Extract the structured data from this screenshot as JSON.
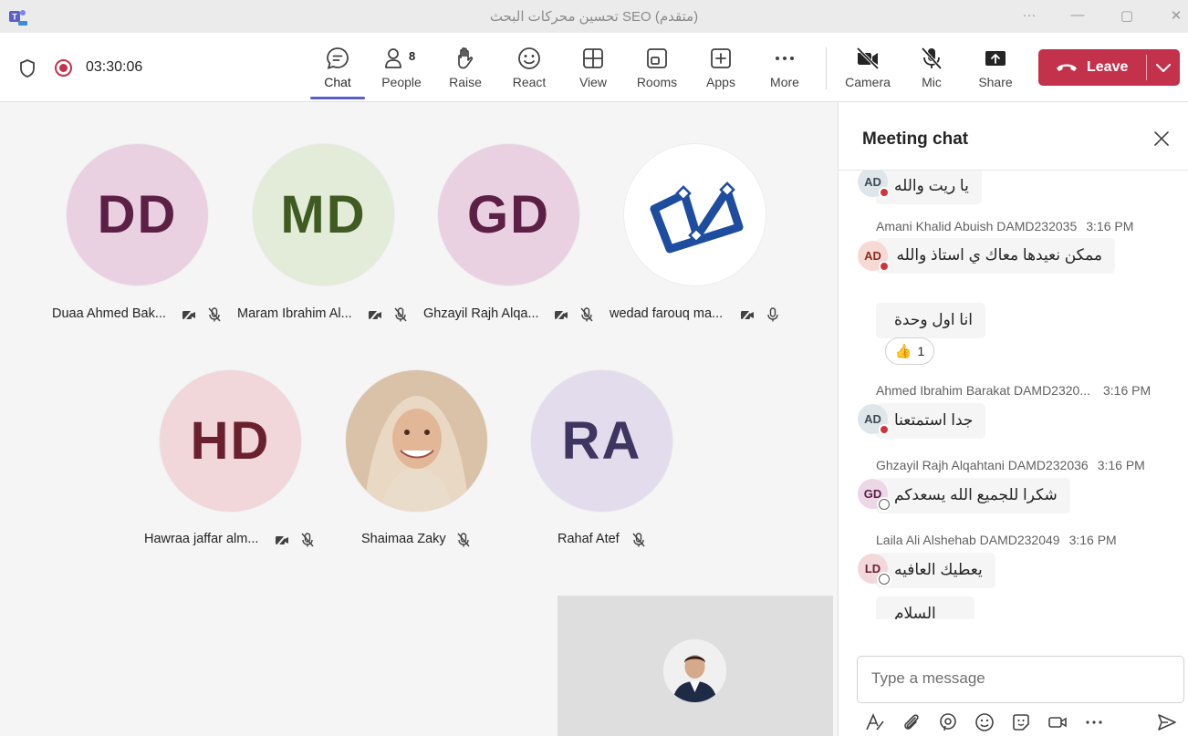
{
  "window": {
    "title": "تحسين محركات البحث SEO (متقدم)",
    "controls": {
      "more": "···",
      "minimize": "—",
      "maximize": "▢",
      "close": "✕"
    }
  },
  "toolbar": {
    "timer": "03:30:06",
    "people_count": "8",
    "buttons": {
      "chat": "Chat",
      "people": "People",
      "raise": "Raise",
      "react": "React",
      "view": "View",
      "rooms": "Rooms",
      "apps": "Apps",
      "more": "More",
      "camera": "Camera",
      "mic": "Mic",
      "share": "Share"
    },
    "leave": "Leave"
  },
  "colors": {
    "accent": "#5b5fc7",
    "leave": "#c4314b",
    "busy": "#d13438"
  },
  "participants": [
    {
      "initials": "DD",
      "name": "Duaa Ahmed Bak...",
      "bg": "#e9d1e1",
      "fg": "#5c1f45"
    },
    {
      "initials": "MD",
      "name": "Maram Ibrahim Al...",
      "bg": "#e3ebd9",
      "fg": "#3f5b22"
    },
    {
      "initials": "GD",
      "name": "Ghzayil Rajh Alqa...",
      "bg": "#e9d1e1",
      "fg": "#5c1f45"
    },
    {
      "initials": "",
      "name": "wedad farouq ma...",
      "bg": "#ffffff",
      "fg": "#1e4da0"
    },
    {
      "initials": "HD",
      "name": "Hawraa jaffar alm...",
      "bg": "#f1d6da",
      "fg": "#6b2030"
    },
    {
      "initials": "",
      "name": "Shaimaa Zaky",
      "bg": "#e8d5c0",
      "fg": "#000000"
    },
    {
      "initials": "RA",
      "name": "Rahaf Atef",
      "bg": "#e3dcec",
      "fg": "#3e3560"
    }
  ],
  "chat": {
    "title": "Meeting chat",
    "messages": [
      {
        "initials": "AD",
        "bubbles": [
          "يا ريت والله"
        ]
      },
      {
        "author": "Amani Khalid Abuish DAMD232035",
        "time": "3:16 PM",
        "initials": "AD",
        "bubbles": [
          "ممكن نعيدها معاك ي استاذ والله",
          "انا اول وحدة"
        ],
        "reaction_count": "1"
      },
      {
        "author": "Ahmed Ibrahim Barakat DAMD2320...",
        "time": "3:16 PM",
        "initials": "AD",
        "bubbles": [
          "جدا استمتعنا"
        ]
      },
      {
        "author": "Ghzayil Rajh Alqahtani DAMD232036",
        "time": "3:16 PM",
        "initials": "GD",
        "bubbles": [
          "شكرا للجميع الله يسعدكم"
        ]
      },
      {
        "author": "Laila Ali Alshehab DAMD232049",
        "time": "3:16 PM",
        "initials": "LD",
        "bubbles": [
          "يعطيك العافيه",
          "السلام"
        ]
      }
    ],
    "compose_placeholder": "Type a message"
  }
}
